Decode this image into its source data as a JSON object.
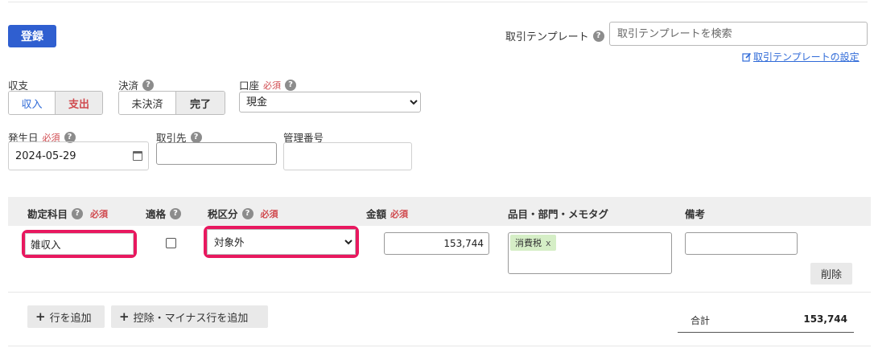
{
  "toolbar": {
    "register_label": "登録"
  },
  "template": {
    "label": "取引テンプレート",
    "search_placeholder": "取引テンプレートを検索",
    "settings_link": "取引テンプレートの設定"
  },
  "form": {
    "type": {
      "label": "収支",
      "options": [
        "収入",
        "支出"
      ],
      "selected": "支出"
    },
    "settlement": {
      "label": "決済",
      "options": [
        "未決済",
        "完了"
      ],
      "selected": "完了"
    },
    "account": {
      "label": "口座",
      "required": "必須",
      "value": "現金"
    },
    "issue_date": {
      "label": "発生日",
      "required": "必須",
      "value": "2024-05-29"
    },
    "partner": {
      "label": "取引先",
      "value": ""
    },
    "mgmt_number": {
      "label": "管理番号",
      "value": ""
    }
  },
  "table": {
    "headers": {
      "account_item": "勘定科目",
      "account_item_required": "必須",
      "qualified": "適格",
      "tax_category": "税区分",
      "tax_required": "必須",
      "amount": "金額",
      "amount_required": "必須",
      "tags": "品目・部門・メモタグ",
      "notes": "備考"
    },
    "row": {
      "account_item": "雑収入",
      "qualified": false,
      "tax_category": "対象外",
      "amount": "153,744",
      "tag": "消費税",
      "tag_remove": "x",
      "notes": "",
      "delete_label": "削除"
    }
  },
  "actions": {
    "add_row": "行を追加",
    "add_deduction": "控除・マイナス行を追加"
  },
  "summary": {
    "total_label": "合計",
    "total_value": "153,744"
  },
  "colors": {
    "primary": "#2f5fd0",
    "highlight": "#e8185f",
    "required": "#d0494e",
    "link": "#2f6ad8",
    "tag_bg": "#d5eec6"
  }
}
